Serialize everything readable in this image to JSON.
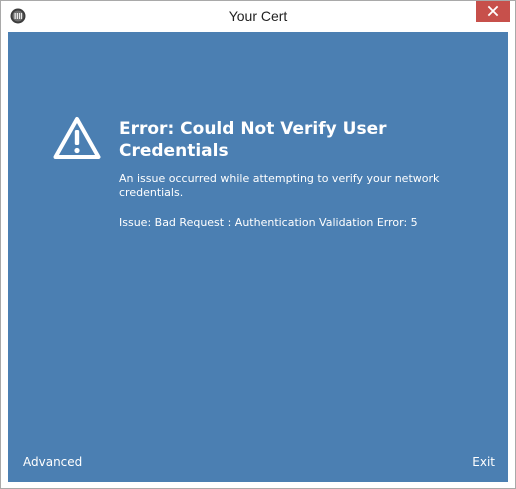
{
  "window": {
    "title": "Your Cert",
    "icon": "app-icon",
    "close_icon": "close-icon"
  },
  "error": {
    "icon": "warning-icon",
    "title": "Error: Could Not Verify User Credentials",
    "description": "An issue occurred while attempting to verify your network credentials.",
    "issue": "Issue: Bad Request : Authentication Validation Error: 5"
  },
  "footer": {
    "advanced_label": "Advanced",
    "exit_label": "Exit"
  },
  "colors": {
    "panel_background": "#4b7fb2",
    "close_button": "#c7504b",
    "text": "#ffffff"
  }
}
